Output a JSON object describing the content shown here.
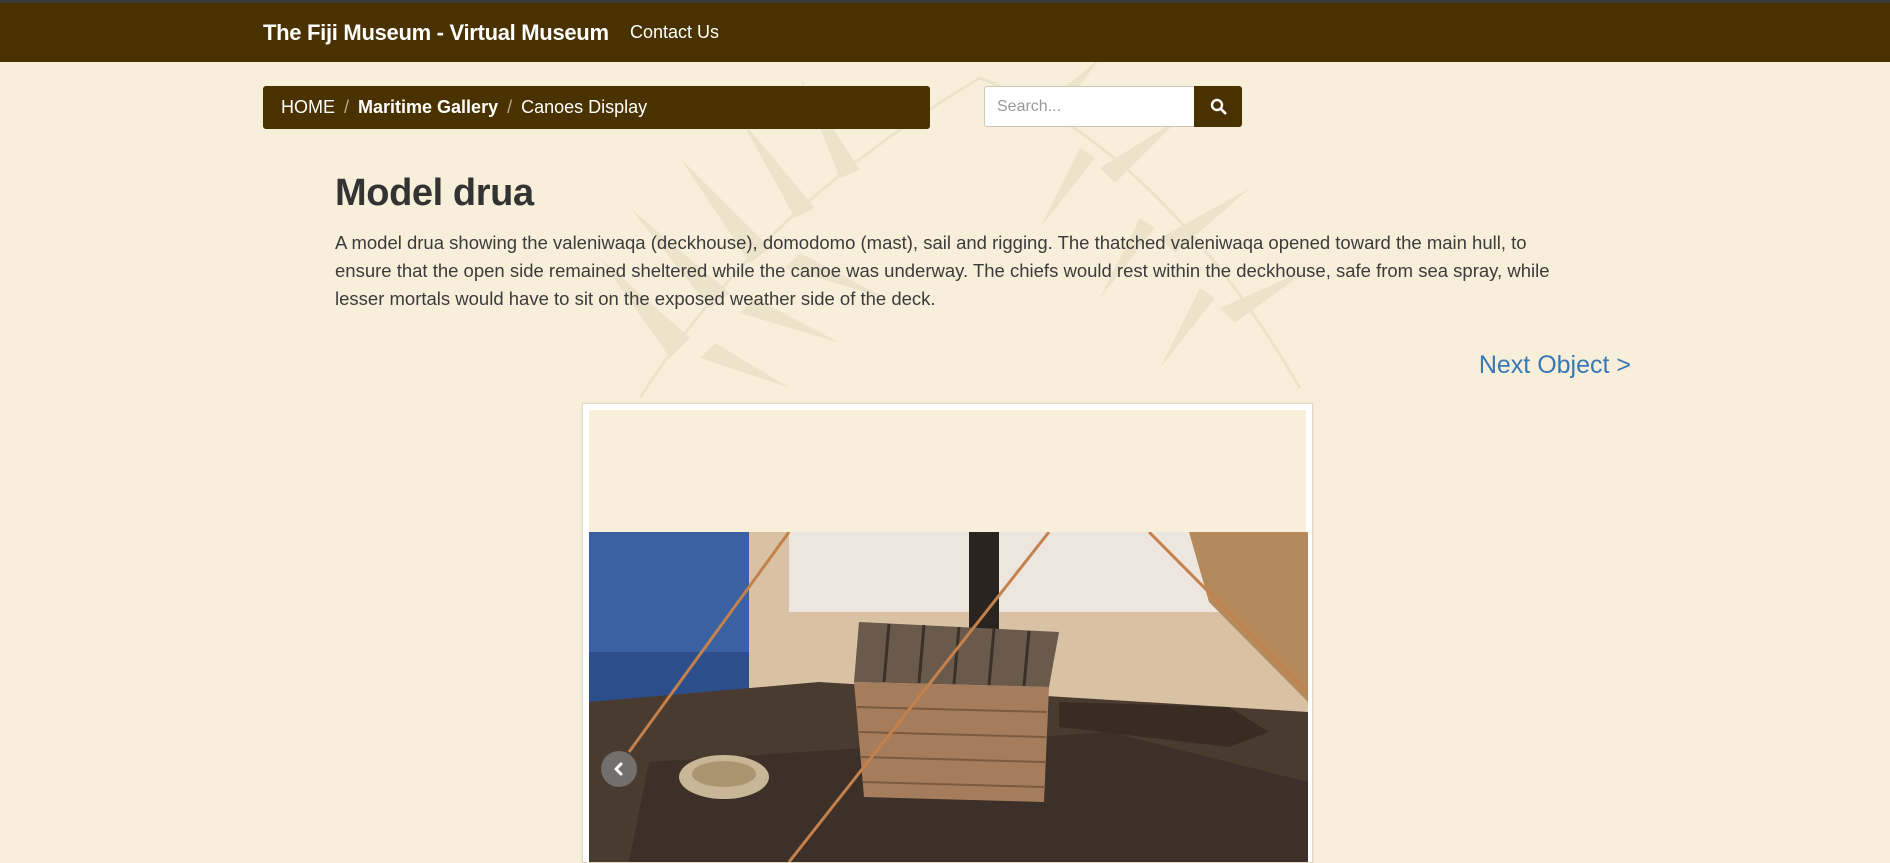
{
  "navbar": {
    "brand": "The Fiji Museum - Virtual Museum",
    "contact_label": "Contact Us",
    "background_color": "#4a3200"
  },
  "breadcrumb": {
    "home": "HOME",
    "gallery": "Maritime Gallery",
    "current": "Canoes Display",
    "separator": "/"
  },
  "search": {
    "placeholder": "Search...",
    "button_icon": "search-icon"
  },
  "object": {
    "title": "Model drua",
    "description": "A model drua showing the valeniwaqa (deckhouse), domodomo (mast), sail and rigging. The thatched valeniwaqa opened toward the main hull, to ensure that the open side remained sheltered while the canoe was underway. The chiefs would rest within the deckhouse, safe from sea spray, while lesser mortals would have to sit on the exposed weather side of the deck.",
    "next_label": "Next Object >"
  },
  "gallery": {
    "prev_icon": "chevron-left-icon"
  },
  "colors": {
    "page_background": "#f7efd9",
    "link": "#3778b5"
  }
}
